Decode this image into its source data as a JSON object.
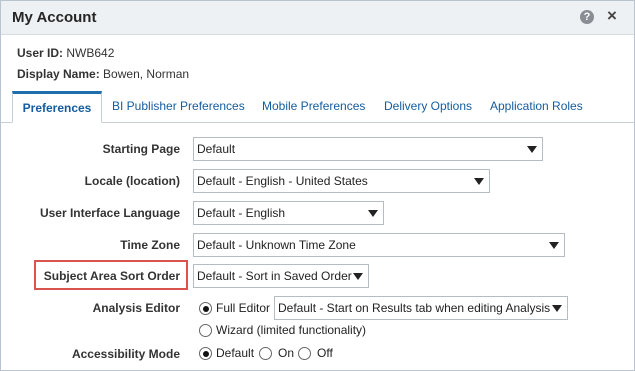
{
  "dialog": {
    "title": "My Account",
    "help_icon": "?",
    "close_icon": "×"
  },
  "info": {
    "user_id_label": "User ID:",
    "user_id_value": "NWB642",
    "display_name_label": "Display Name:",
    "display_name_value": "Bowen, Norman"
  },
  "tabs": [
    {
      "label": "Preferences",
      "active": true
    },
    {
      "label": "BI Publisher Preferences",
      "active": false
    },
    {
      "label": "Mobile Preferences",
      "active": false
    },
    {
      "label": "Delivery Options",
      "active": false
    },
    {
      "label": "Application Roles",
      "active": false
    }
  ],
  "form": {
    "starting_page": {
      "label": "Starting Page",
      "value": "Default"
    },
    "locale": {
      "label": "Locale (location)",
      "value": "Default - English - United States"
    },
    "ui_language": {
      "label": "User Interface Language",
      "value": "Default - English"
    },
    "time_zone": {
      "label": "Time Zone",
      "value": "Default - Unknown Time Zone"
    },
    "subject_area_sort": {
      "label": "Subject Area Sort Order",
      "value": "Default - Sort in Saved Order"
    },
    "analysis_editor": {
      "label": "Analysis Editor",
      "option_full": "Full Editor",
      "option_wizard": "Wizard (limited functionality)",
      "full_editor_value": "Default - Start on Results tab when editing Analysis",
      "selected": "full"
    },
    "accessibility": {
      "label": "Accessibility Mode",
      "option_default": "Default",
      "option_on": "On",
      "option_off": "Off",
      "selected": "default"
    }
  },
  "colors": {
    "highlight": "#d9534f",
    "tab_accent": "#1f6ead",
    "link": "#145c9e"
  }
}
